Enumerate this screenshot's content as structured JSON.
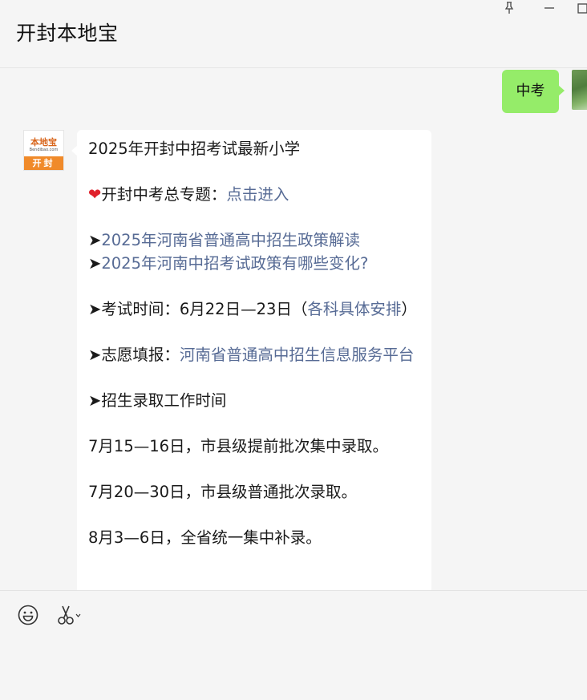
{
  "window": {
    "title": "开封本地宝",
    "controls": {
      "pin": "pin-icon",
      "minimize": "minimize-icon",
      "maximize": "maximize-icon"
    }
  },
  "chat": {
    "sent_message": "中考",
    "bot_avatar": {
      "brand": "本地宝",
      "site": "Bendibao.com",
      "city": "开封"
    },
    "bot_message": {
      "line1": "2025年开封中招考试最新小学",
      "heart_emoji": "❤",
      "topic_prefix": "开封中考总专题：",
      "topic_link": "点击进入",
      "arrow": "➤",
      "link_policy": "2025年河南省普通高中招生政策解读",
      "link_changes": "2025年河南中招考试政策有哪些变化?",
      "exam_time_prefix": "考试时间：6月22日—23日（",
      "exam_time_link": "各科具体安排",
      "exam_time_suffix": "）",
      "volunteer_prefix": "志愿填报：",
      "volunteer_link": "河南省普通高中招生信息服务平台",
      "admission_heading": "招生录取工作时间",
      "batch1": "7月15—16日，市县级提前批次集中录取。",
      "batch2": "7月20—30日，市县级普通批次录取。",
      "batch3": "8月3—6日，全省统一集中补录。"
    }
  },
  "composer": {
    "emoji_icon": "emoji-icon",
    "scissors_icon": "scissors-icon"
  },
  "colors": {
    "sent_bubble": "#95ec69",
    "link": "#576b95",
    "accent": "#f08a2a"
  }
}
